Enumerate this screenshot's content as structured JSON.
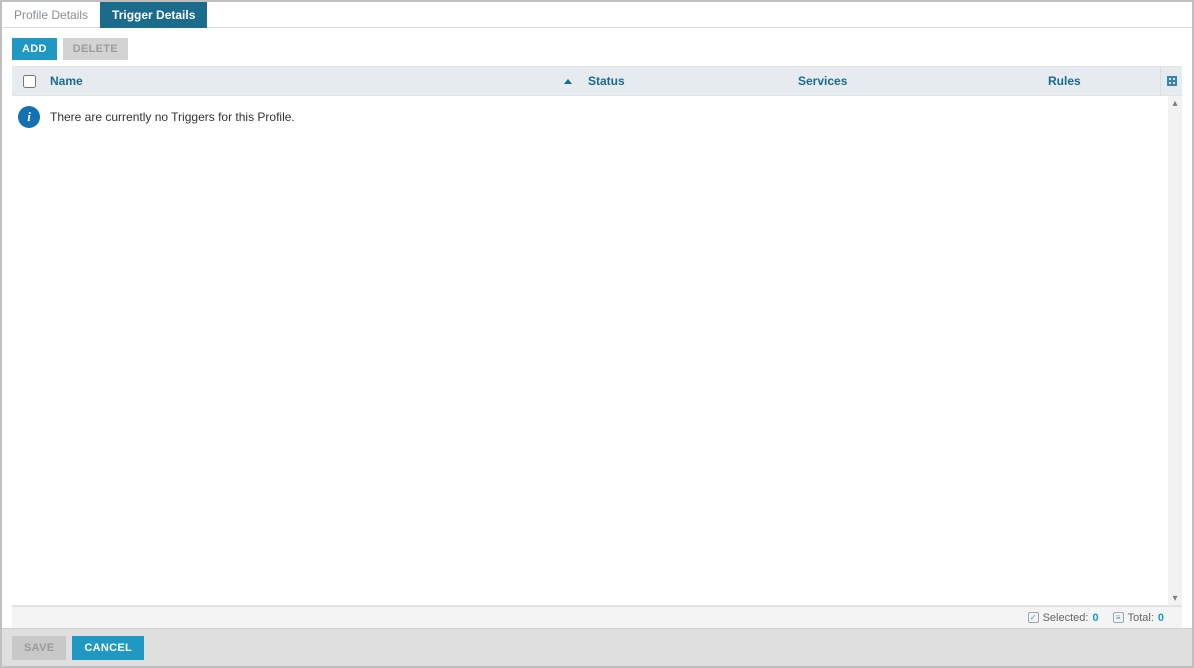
{
  "tabs": [
    {
      "label": "Profile Details",
      "active": false
    },
    {
      "label": "Trigger Details",
      "active": true
    }
  ],
  "toolbar": {
    "add_label": "ADD",
    "delete_label": "DELETE"
  },
  "columns": {
    "name": "Name",
    "status": "Status",
    "services": "Services",
    "rules": "Rules"
  },
  "empty_message": "There are currently no Triggers for this Profile.",
  "status": {
    "selected_label": "Selected:",
    "selected_value": "0",
    "total_label": "Total:",
    "total_value": "0"
  },
  "footer": {
    "save_label": "SAVE",
    "cancel_label": "CANCEL"
  }
}
